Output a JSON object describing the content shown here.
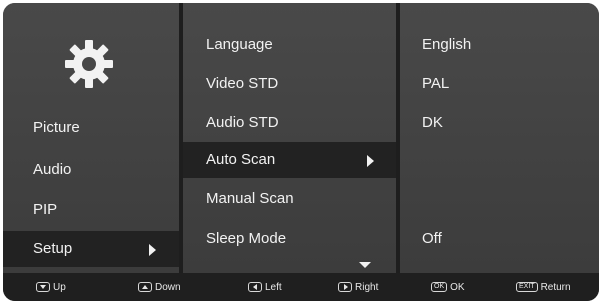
{
  "categories": [
    {
      "label": "Picture"
    },
    {
      "label": "Audio"
    },
    {
      "label": "PIP"
    },
    {
      "label": "Setup"
    }
  ],
  "setup_options": [
    {
      "label": "Language",
      "value": "English"
    },
    {
      "label": "Video STD",
      "value": "PAL"
    },
    {
      "label": "Audio STD",
      "value": "DK"
    },
    {
      "label": "Auto Scan",
      "value": ""
    },
    {
      "label": "Manual Scan",
      "value": ""
    },
    {
      "label": "Sleep Mode",
      "value": "Off"
    }
  ],
  "selected_category": "Setup",
  "selected_option": "Auto Scan",
  "footer": {
    "up": "Up",
    "down": "Down",
    "left": "Left",
    "right": "Right",
    "ok_key": "OK",
    "ok": "OK",
    "exit_key": "EXIT",
    "return": "Return"
  },
  "icons": {
    "settings": "gear-icon"
  },
  "colors": {
    "panel": "#444444",
    "selected": "#222222",
    "footer": "#1f1f1f",
    "text": "#f2f2f2"
  }
}
